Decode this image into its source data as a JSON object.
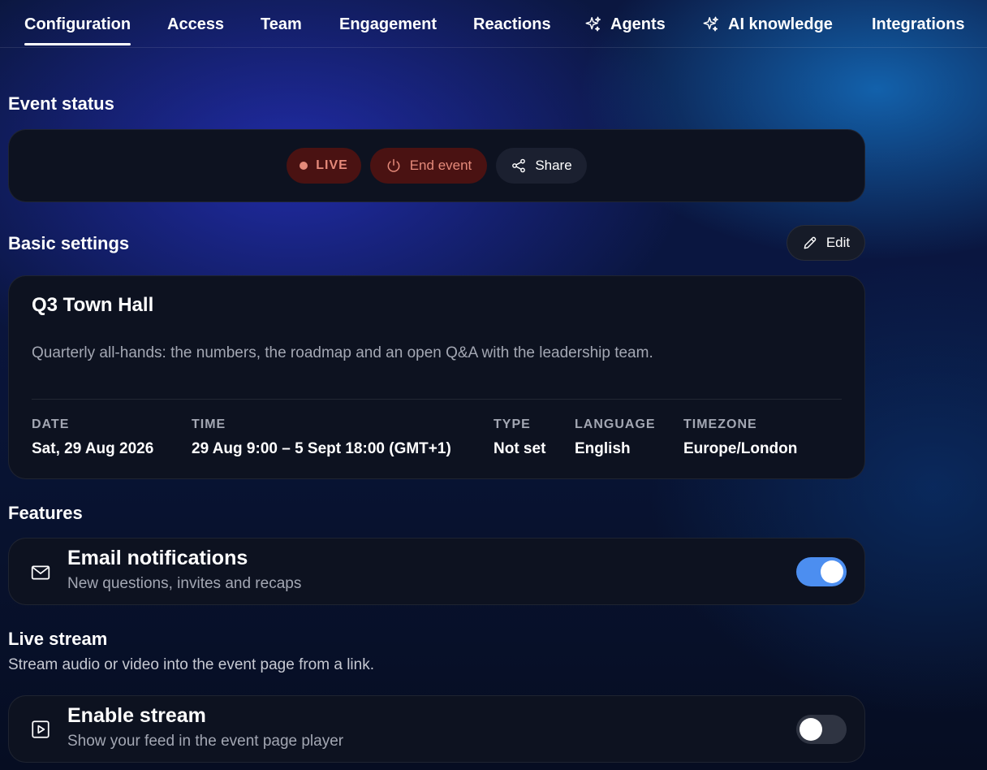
{
  "nav": {
    "tabs": [
      {
        "label": "Configuration",
        "icon": null
      },
      {
        "label": "Access",
        "icon": null
      },
      {
        "label": "Team",
        "icon": null
      },
      {
        "label": "Engagement",
        "icon": null
      },
      {
        "label": "Reactions",
        "icon": null
      },
      {
        "label": "Agents",
        "icon": "sparkles-icon"
      },
      {
        "label": "AI knowledge",
        "icon": "sparkles-icon"
      },
      {
        "label": "Integrations",
        "icon": null
      }
    ],
    "active_tab": "Configuration"
  },
  "event_status": {
    "title": "Event status",
    "live_label": "LIVE",
    "end_label": "End event",
    "share_label": "Share"
  },
  "basic_settings": {
    "title": "Basic settings",
    "edit_label": "Edit",
    "event_name": "Q3 Town Hall",
    "description": "Quarterly all-hands: the numbers, the roadmap and an open Q&A with the leadership team.",
    "meta": [
      {
        "key": "DATE",
        "value": "Sat, 29 Aug 2026"
      },
      {
        "key": "TIME",
        "value": "29 Aug 9:00 – 5 Sept 18:00 (GMT+1)"
      },
      {
        "key": "TYPE",
        "value": "Not set"
      },
      {
        "key": "LANGUAGE",
        "value": "English"
      },
      {
        "key": "TIMEZONE",
        "value": "Europe/London"
      }
    ]
  },
  "features": {
    "title": "Features",
    "email": {
      "title": "Email notifications",
      "subtitle": "New questions, invites and recaps",
      "enabled": true,
      "icon": "mail-icon"
    }
  },
  "live_stream": {
    "title": "Live stream",
    "subtitle": "Stream audio or video into the event page from a link.",
    "enable": {
      "title": "Enable stream",
      "subtitle": "Show your feed in the event page player",
      "enabled": false,
      "icon": "play-icon"
    }
  },
  "colors": {
    "accent_toggle": "#4c8ef0",
    "danger_bg": "#4a1212",
    "danger_text": "#e58a7a",
    "card_bg": "#0d1220"
  }
}
